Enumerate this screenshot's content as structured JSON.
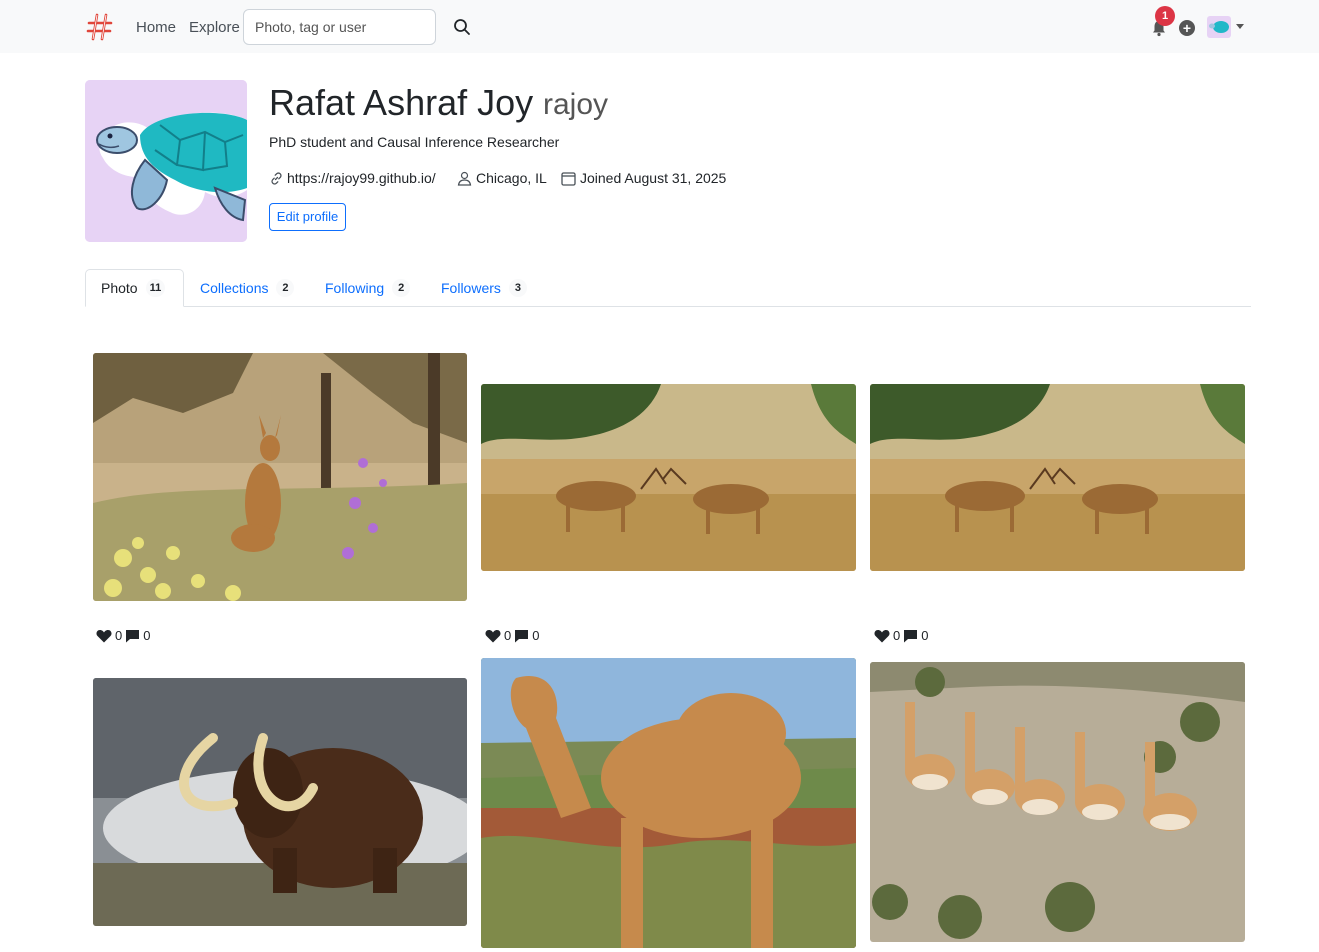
{
  "nav": {
    "home_label": "Home",
    "explore_label": "Explore",
    "search_placeholder": "Photo, tag or user",
    "notification_count": "1",
    "add_label": "+"
  },
  "profile": {
    "name": "Rafat Ashraf Joy",
    "username": "rajoy",
    "bio": "PhD student and Causal Inference Researcher",
    "website": "https://rajoy99.github.io/",
    "location": "Chicago, IL",
    "joined": "Joined August 31, 2025",
    "edit_label": "Edit profile"
  },
  "tabs": [
    {
      "label": "Photo",
      "count": "11"
    },
    {
      "label": "Collections",
      "count": "2"
    },
    {
      "label": "Following",
      "count": "2"
    },
    {
      "label": "Followers",
      "count": "3"
    }
  ],
  "photos": [
    {
      "subject": "kangaroo",
      "likes": "0",
      "comments": "0"
    },
    {
      "subject": "spotted-deer-sparring",
      "likes": "0",
      "comments": "0"
    },
    {
      "subject": "spotted-deer-sparring",
      "likes": "0",
      "comments": "0"
    },
    {
      "subject": "woolly-mammoth"
    },
    {
      "subject": "camel"
    },
    {
      "subject": "vicunas"
    }
  ],
  "colors": {
    "accent": "#0d6efd",
    "badge": "#dc3545",
    "navbar_bg": "#f8f9fa",
    "logo": "#e0453a"
  }
}
